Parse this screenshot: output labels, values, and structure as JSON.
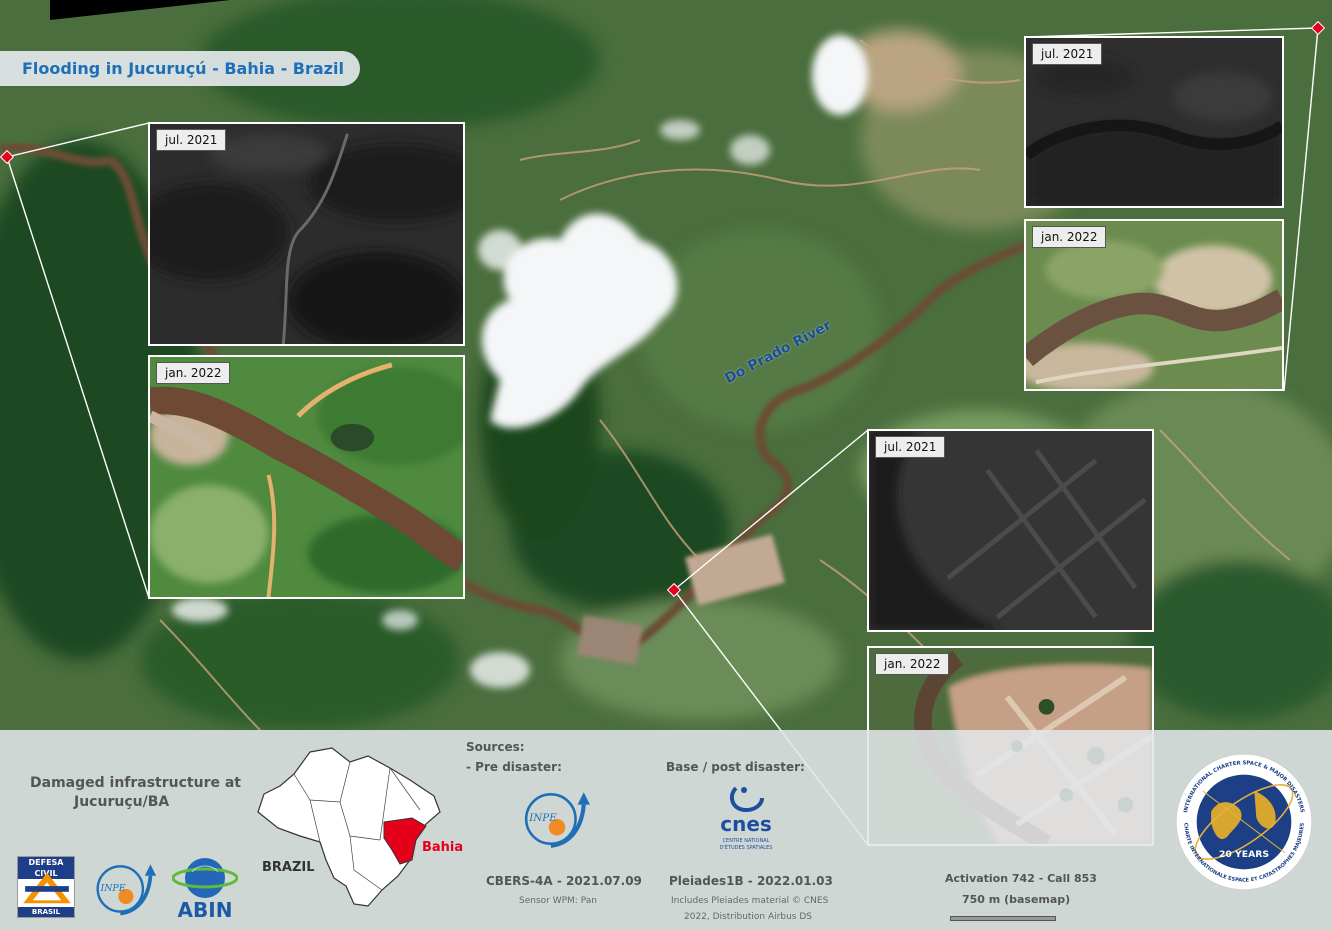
{
  "title": "Flooding in Jucuruçú - Bahia - Brazil",
  "river_label": "Do Prado River",
  "insets": {
    "left_top": "jul. 2021",
    "left_bottom": "jan. 2022",
    "right_top": "jul. 2021",
    "right_bottom": "jan. 2022",
    "center_top": "jul. 2021",
    "center_bottom": "jan. 2022"
  },
  "footer": {
    "damaged_line1": "Damaged infrastructure at",
    "damaged_line2": "Jucuruçu/BA",
    "brazil": "BRAZIL",
    "bahia": "Bahia",
    "sources": "Sources:",
    "pre_disaster": "- Pre disaster:",
    "base_post": "Base / post disaster:",
    "cbers": "CBERS-4A - 2021.07.09",
    "sensor": "Sensor WPM: Pan",
    "pleiades": "Pleiades1B - 2022.01.03",
    "pleiades_note1": "Includes Pleiades material © CNES",
    "pleiades_note2": "2022, Distribution Airbus DS",
    "activation": "Activation 742 - Call 853",
    "scale": "750 m (basemap)"
  },
  "logos": {
    "defesa_top": "DEFESA CIVIL",
    "defesa_bottom": "BRASIL",
    "inpe": "INPE",
    "abin": "ABIN",
    "cnes": "cnes",
    "cnes_sub1": "CENTRE NATIONAL",
    "cnes_sub2": "D'ÉTUDES SPATIALES",
    "charter_years": "20 YEARS",
    "charter_ring_top": "INTERNATIONAL CHARTER SPACE & MAJOR DISASTERS",
    "charter_ring_bottom": "CHARTE INTERNATIONALE ESPACE ET CATASTROPHES MAJEURES"
  },
  "colors": {
    "title": "#1d6fb7",
    "river_label": "#1a4d95",
    "bahia": "#e4001b",
    "marker": "#e4001b"
  }
}
